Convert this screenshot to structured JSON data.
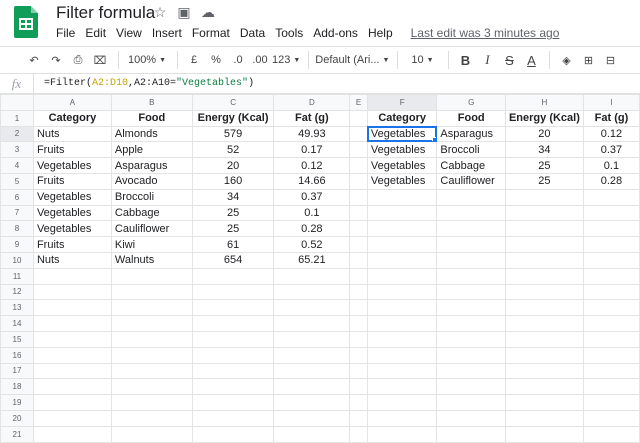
{
  "app": {
    "title": "Filter formula",
    "icons": {
      "star": "☆",
      "folder": "▣",
      "cloud": "☁"
    },
    "menu": [
      "File",
      "Edit",
      "View",
      "Insert",
      "Format",
      "Data",
      "Tools",
      "Add-ons",
      "Help"
    ],
    "last_edit": "Last edit was 3 minutes ago"
  },
  "toolbar": {
    "undo": "↶",
    "redo": "↷",
    "print": "⎙",
    "paint_format": "⌧",
    "zoom": "100%",
    "currency": "£",
    "percent": "%",
    "decrease_decimal": ".0",
    "increase_decimal": ".00",
    "more_formats": "123",
    "font": "Default (Ari...",
    "font_size": "10",
    "bold": "B",
    "italic": "I",
    "strike": "S",
    "text_color": "A",
    "fill_color": "◈",
    "borders": "⊞",
    "merge": "⊟"
  },
  "formula_bar": {
    "fx": "fx",
    "prefix": "=Filter(",
    "range1": "A2:D10",
    "middle": ",A2:A10=",
    "string": "\"Vegetables\"",
    "suffix": ")"
  },
  "sheet": {
    "columns": [
      "A",
      "B",
      "C",
      "D",
      "E",
      "F",
      "G",
      "H",
      "I"
    ],
    "rows": [
      "1",
      "2",
      "3",
      "4",
      "5",
      "6",
      "7",
      "8",
      "9",
      "10",
      "11",
      "12",
      "13",
      "14",
      "15",
      "16",
      "17",
      "18",
      "19",
      "20",
      "21"
    ],
    "headers": [
      "Category",
      "Food",
      "Energy (Kcal)",
      "Fat (g)"
    ],
    "source": [
      [
        "Nuts",
        "Almonds",
        "579",
        "49.93"
      ],
      [
        "Fruits",
        "Apple",
        "52",
        "0.17"
      ],
      [
        "Vegetables",
        "Asparagus",
        "20",
        "0.12"
      ],
      [
        "Fruits",
        "Avocado",
        "160",
        "14.66"
      ],
      [
        "Vegetables",
        "Broccoli",
        "34",
        "0.37"
      ],
      [
        "Vegetables",
        "Cabbage",
        "25",
        "0.1"
      ],
      [
        "Vegetables",
        "Cauliflower",
        "25",
        "0.28"
      ],
      [
        "Fruits",
        "Kiwi",
        "61",
        "0.52"
      ],
      [
        "Nuts",
        "Walnuts",
        "654",
        "65.21"
      ]
    ],
    "filtered": [
      [
        "Vegetables",
        "Asparagus",
        "20",
        "0.12"
      ],
      [
        "Vegetables",
        "Broccoli",
        "34",
        "0.37"
      ],
      [
        "Vegetables",
        "Cabbage",
        "25",
        "0.1"
      ],
      [
        "Vegetables",
        "Cauliflower",
        "25",
        "0.28"
      ]
    ],
    "selected_cell": "F2"
  },
  "colors": {
    "brand": "#0f9d58",
    "selection": "#1a73e8",
    "range_highlight": "#c9a100",
    "string_literal": "#0b8043"
  }
}
